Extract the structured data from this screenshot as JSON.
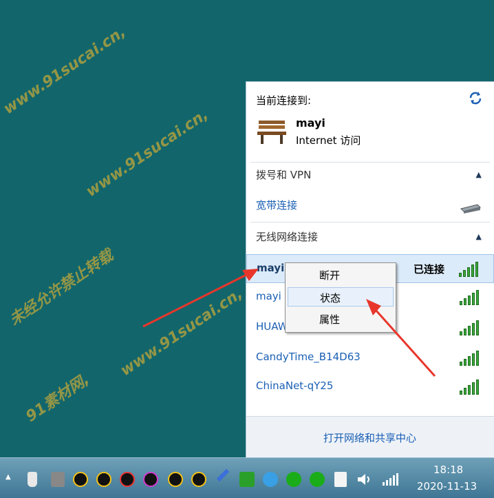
{
  "flyout": {
    "current_label": "当前连接到:",
    "current_network": {
      "name": "mayi",
      "status": "Internet 访问"
    },
    "dialup_section": "拨号和 VPN",
    "dialup_items": [
      {
        "label": "宽带连接"
      }
    ],
    "wireless_section": "无线网络连接",
    "networks": [
      {
        "name": "mayi",
        "status": "已连接",
        "selected": true
      },
      {
        "name": "mayi"
      },
      {
        "name": "HUAW"
      },
      {
        "name": "CandyTime_B14D63"
      },
      {
        "name": "ChinaNet-qY25"
      }
    ],
    "footer_link": "打开网络和共享中心"
  },
  "context_menu": {
    "items": [
      {
        "label": "断开"
      },
      {
        "label": "状态",
        "highlighted": true
      },
      {
        "label": "属性"
      }
    ]
  },
  "taskbar": {
    "time": "18:18",
    "date": "2020-11-13",
    "tray_icons": [
      "show-hidden-icon",
      "usb-icon",
      "safely-remove-icon",
      "qq-icon",
      "qq-icon",
      "qq-icon",
      "qq-icon",
      "qq-icon",
      "qq-icon",
      "tool-icon",
      "app-green-icon",
      "app-blue-icon",
      "wechat-icon",
      "wechat-icon",
      "clipboard-icon",
      "volume-icon",
      "network-signal-icon"
    ]
  },
  "watermark": [
    "91素材网,",
    "www.91sucai.cn,",
    "未经允许禁止转载"
  ],
  "colors": {
    "desktop": "#12666b",
    "link": "#1a5fb4",
    "signal": "#3aa63a",
    "arrow": "#e8362b",
    "selected_row": "#dcebfa"
  }
}
